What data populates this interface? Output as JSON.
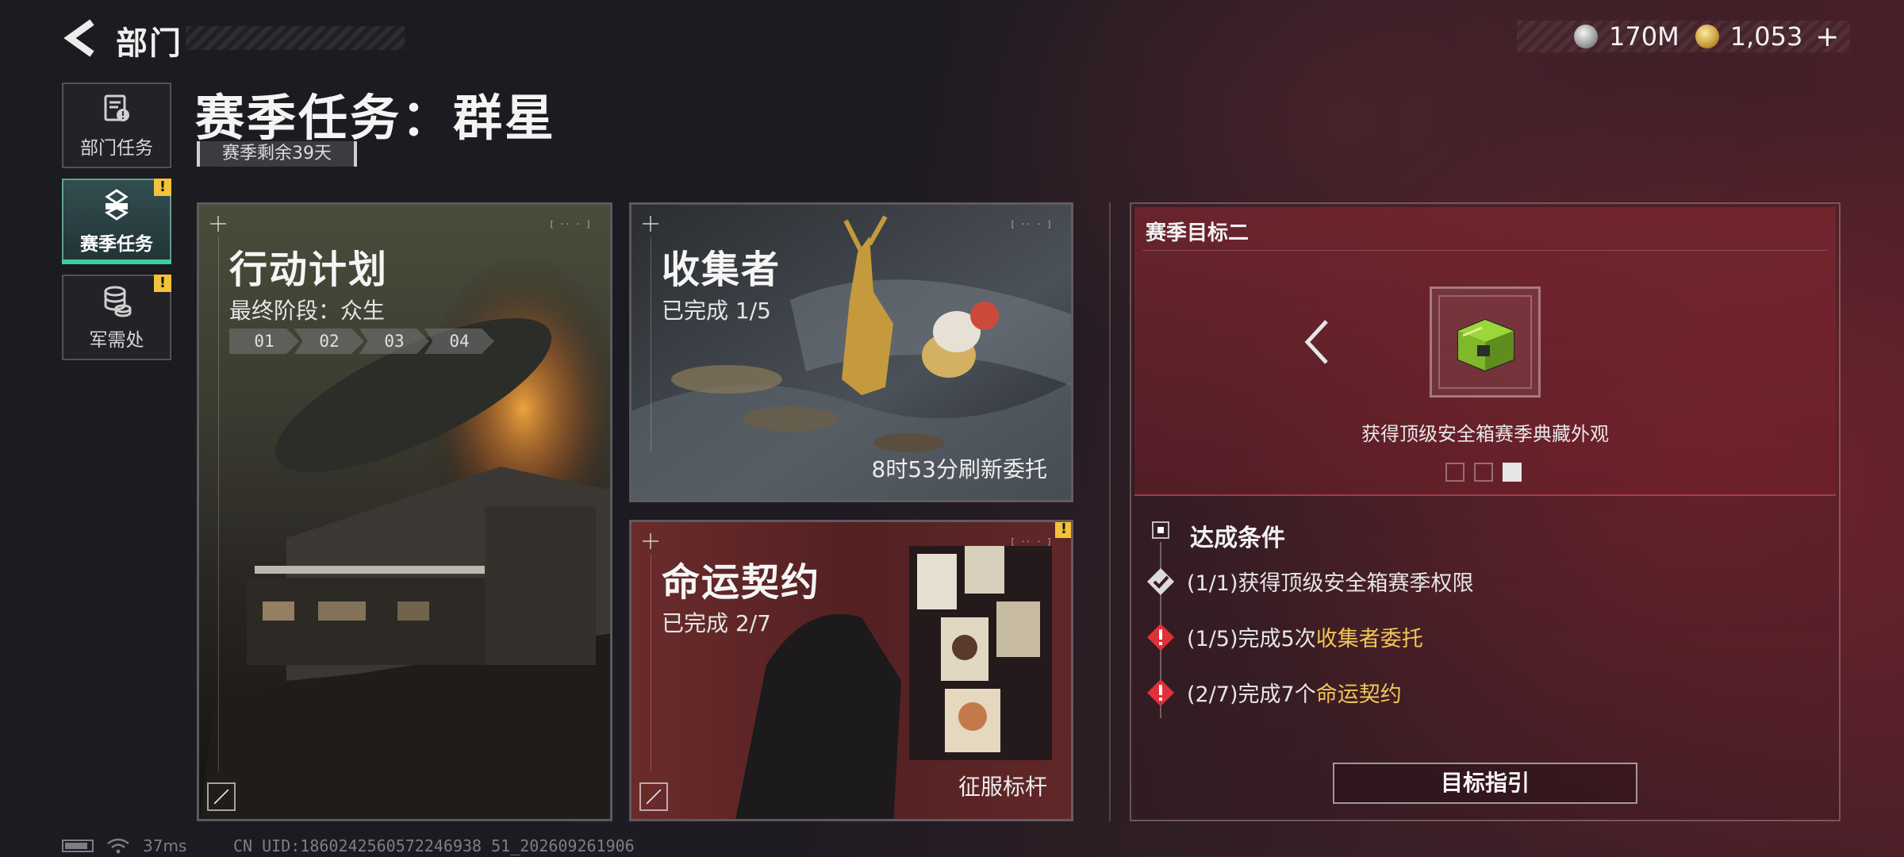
{
  "header": {
    "back_label": "部门"
  },
  "currency": {
    "silver_value": "170M",
    "gold_value": "1,053",
    "plus_label": "+"
  },
  "sidebar": {
    "items": [
      {
        "label": "部门任务",
        "icon": "clipboard-icon",
        "active": false,
        "alert": false
      },
      {
        "label": "赛季任务",
        "icon": "season-task-icon",
        "active": true,
        "alert": true
      },
      {
        "label": "军需处",
        "icon": "coins-stack-icon",
        "active": false,
        "alert": true
      }
    ],
    "alert_mark": "!"
  },
  "page": {
    "title": "赛季任务：群星",
    "season_remaining": "赛季剩余39天"
  },
  "cards": {
    "action_plan": {
      "title": "行动计划",
      "subtitle": "最终阶段：众生",
      "stages": [
        "01",
        "02",
        "03",
        "04"
      ]
    },
    "collector": {
      "title": "收集者",
      "progress": "已完成 1/5",
      "footer": "8时53分刷新委托"
    },
    "fate": {
      "title": "命运契约",
      "progress": "已完成 2/7",
      "footer": "征服标杆",
      "alert": true
    }
  },
  "goal": {
    "title": "赛季目标二",
    "reward_text": "获得顶级安全箱赛季典藏外观",
    "page_index": 3,
    "page_count": 3,
    "conditions_heading": "达成条件",
    "conditions": [
      {
        "prefix": "(1/1)获得顶级安全箱赛季权限",
        "highlight": "",
        "status": "done"
      },
      {
        "prefix": "(1/5)完成5次",
        "highlight": "收集者委托",
        "status": "incomplete"
      },
      {
        "prefix": "(2/7)完成7个",
        "highlight": "命运契约",
        "status": "incomplete"
      }
    ],
    "guide_button": "目标指引"
  },
  "status_bar": {
    "ping": "37ms",
    "uid": "CN UID:1860242560572246938 51_202609261906"
  },
  "colors": {
    "accent_green": "#3ccf9c",
    "alert_yellow": "#f2c23a",
    "highlight_gold": "#f2c656",
    "incomplete_red": "#e0303a"
  }
}
